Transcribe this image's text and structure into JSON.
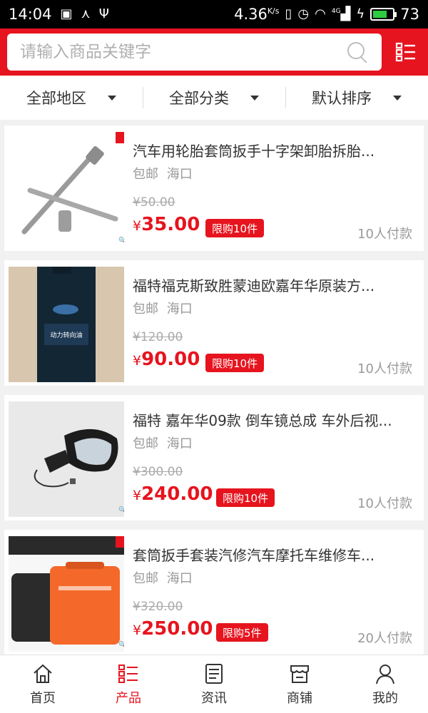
{
  "status_bar": {
    "time": "14:04",
    "speed": "4.36",
    "speed_unit": "K/s",
    "battery": "73",
    "battery_fill": 0.73,
    "network": "4G"
  },
  "search": {
    "placeholder": "请输入商品关键字"
  },
  "filters": [
    {
      "label": "全部地区"
    },
    {
      "label": "全部分类"
    },
    {
      "label": "默认排序"
    }
  ],
  "products": [
    {
      "title": "汽车用轮胎套筒扳手十字架卸胎拆胎...",
      "shipping": "包邮",
      "location": "海口",
      "old_price": "¥50.00",
      "currency": "¥",
      "price": "35.00",
      "limit": "限购10件",
      "sold": "10人付款",
      "image": "cross-lug-wrench"
    },
    {
      "title": "福特福克斯致胜蒙迪欧嘉年华原装方...",
      "shipping": "包邮",
      "location": "海口",
      "old_price": "¥120.00",
      "currency": "¥",
      "price": "90.00",
      "limit": "限购10件",
      "sold": "10人付款",
      "image": "power-steering-fluid-bottle",
      "image_text": "动力转向油"
    },
    {
      "title": "福特 嘉年华09款 倒车镜总成 车外后视...",
      "shipping": "包邮",
      "location": "海口",
      "old_price": "¥300.00",
      "currency": "¥",
      "price": "240.00",
      "limit": "限购10件",
      "sold": "10人付款",
      "image": "side-mirror"
    },
    {
      "title": "套筒扳手套装汽修汽车摩托车维修车...",
      "shipping": "包邮",
      "location": "海口",
      "old_price": "¥320.00",
      "currency": "¥",
      "price": "250.00",
      "limit": "限购5件",
      "sold": "20人付款",
      "image": "tool-cases"
    }
  ],
  "tabs": [
    {
      "label": "首页",
      "icon": "home-icon"
    },
    {
      "label": "产品",
      "icon": "list-icon"
    },
    {
      "label": "资讯",
      "icon": "news-icon"
    },
    {
      "label": "商铺",
      "icon": "store-icon"
    },
    {
      "label": "我的",
      "icon": "user-icon"
    }
  ],
  "colors": {
    "accent": "#e6141e",
    "muted": "#999999"
  }
}
